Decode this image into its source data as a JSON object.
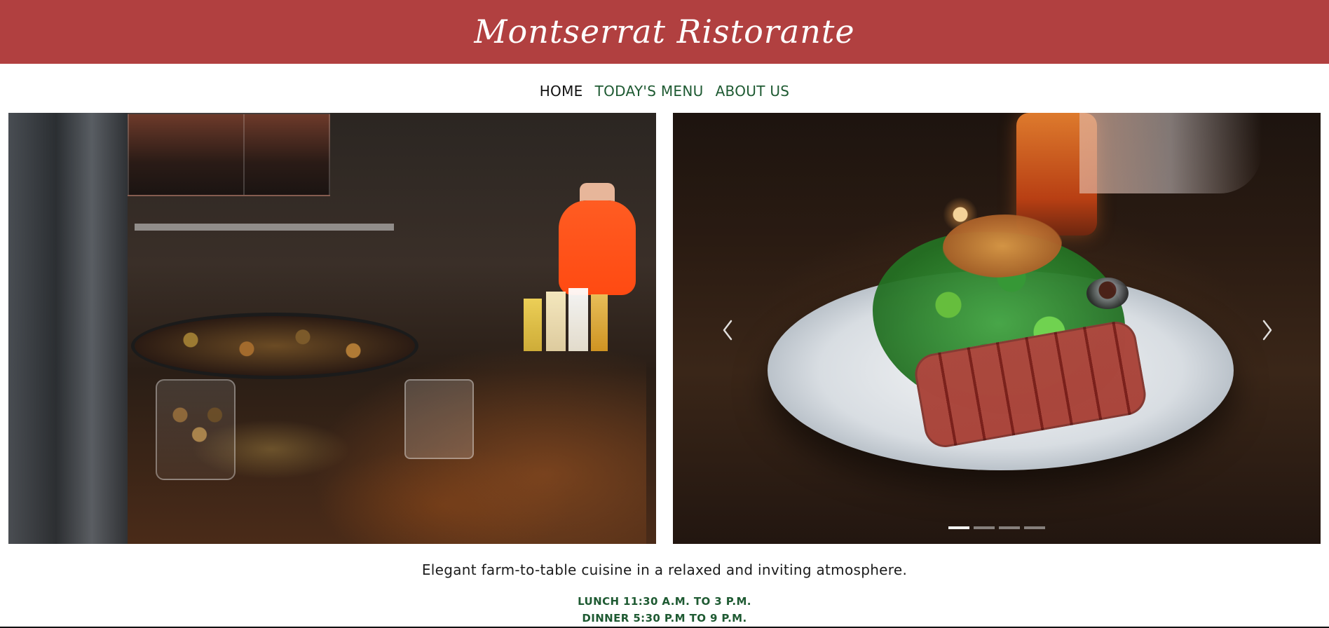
{
  "header": {
    "brand": "Montserrat Ristorante",
    "background_color": "#b14040"
  },
  "nav": {
    "items": [
      {
        "label": "HOME",
        "active": true
      },
      {
        "label": "TODAY'S MENU",
        "active": false
      },
      {
        "label": "ABOUT US",
        "active": false
      }
    ],
    "active_color": "#111111",
    "link_color": "#1e5a32"
  },
  "gallery": {
    "left_image_icon": "kitchen-photo",
    "right_image_icon": "plated-salad-photo",
    "carousel": {
      "prev_icon": "chevron-left-icon",
      "next_icon": "chevron-right-icon",
      "indicator_count": 4,
      "active_indicator_index": 0
    }
  },
  "intro": {
    "tagline": "Elegant farm-to-table cuisine in a relaxed and inviting atmosphere."
  },
  "hours": {
    "lunch": "LUNCH 11:30 A.M. TO 3 P.M.",
    "dinner": "DINNER 5:30 P.M TO 9 P.M."
  }
}
